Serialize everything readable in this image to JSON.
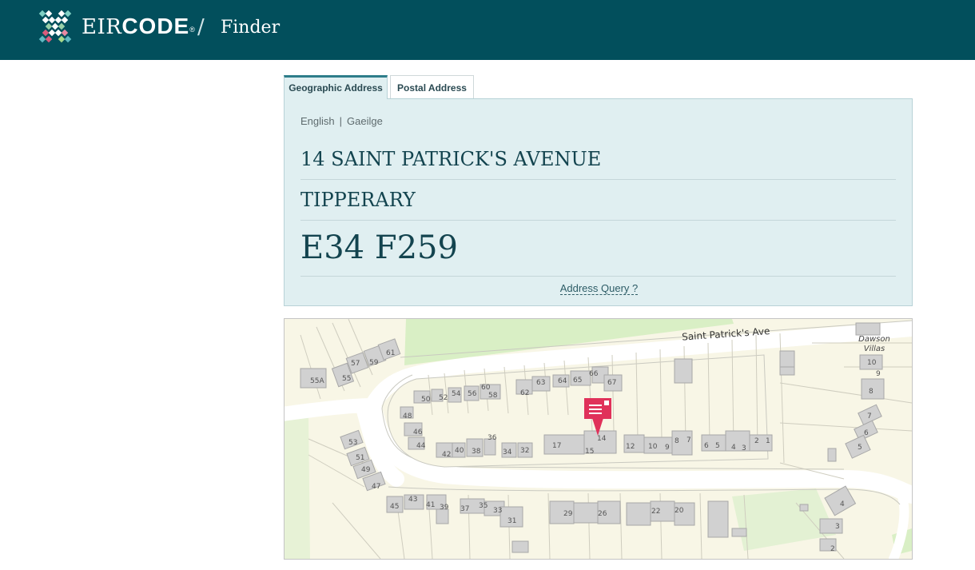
{
  "header": {
    "brand_light": "EIR",
    "brand_bold": "CODE",
    "brand_mark": "®",
    "separator": "/",
    "section": "Finder"
  },
  "tabs": [
    {
      "label": "Geographic Address",
      "active": true
    },
    {
      "label": "Postal Address",
      "active": false
    }
  ],
  "languages": {
    "english": "English",
    "separator": "|",
    "irish": "Gaeilge"
  },
  "address": {
    "line1": "14 SAINT PATRICK'S AVENUE",
    "line2": "TIPPERARY",
    "eircode": "E34 F259"
  },
  "address_query_link": "Address Query ?",
  "map": {
    "street_label": "Saint Patrick's Ave",
    "place_label_1": "Dawson",
    "place_label_2": "Villas",
    "marker_icon": "location-pin-icon",
    "house_numbers": {
      "n61": "61",
      "n59": "59",
      "n57": "57",
      "n55": "55",
      "n55a": "55A",
      "n66": "66",
      "n65": "65",
      "n64": "64",
      "n67": "67",
      "n63": "63",
      "n62": "62",
      "n60": "60",
      "n58": "58",
      "n56": "56",
      "n54": "54",
      "n52": "52",
      "n50": "50",
      "n48": "48",
      "n46": "46",
      "n44": "44",
      "n42": "42",
      "n40": "40",
      "n38": "38",
      "n36": "36",
      "n34": "34",
      "n32": "32",
      "n17": "17",
      "n15": "15",
      "n14": "14",
      "n12": "12",
      "n10": "10",
      "n9": "9",
      "n8": "8",
      "n7": "7",
      "n6": "6",
      "n5": "5",
      "n4": "4",
      "n3": "3",
      "n2": "2",
      "n1": "1",
      "n53": "53",
      "n51": "51",
      "n49": "49",
      "n47": "47",
      "n45": "45",
      "n43": "43",
      "n41": "41",
      "n39": "39",
      "n37": "37",
      "n35": "35",
      "n33": "33",
      "n31": "31",
      "n29": "29",
      "n26": "26",
      "n22": "22",
      "n20": "20",
      "r10": "10",
      "r9": "9",
      "r8": "8",
      "r7": "7",
      "r6": "6",
      "r5": "5",
      "b4": "4",
      "b3": "3",
      "b2": "2"
    }
  },
  "colors": {
    "header_bg": "#024f5c",
    "panel_bg": "#e0eff1",
    "address_text": "#13444f",
    "marker": "#e0315a",
    "green_area": "#d9efc5",
    "road": "#ffffff",
    "buildings": "#d1d1d1"
  }
}
